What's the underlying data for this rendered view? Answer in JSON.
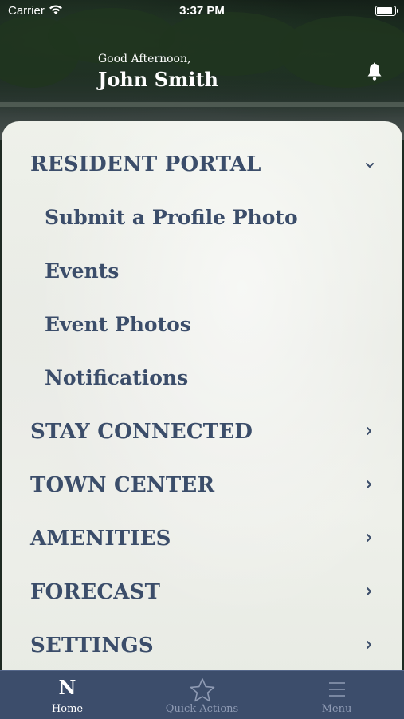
{
  "status_bar": {
    "carrier": "Carrier",
    "time": "3:37 PM",
    "battery_level": 0.95
  },
  "header": {
    "greeting": "Good Afternoon,",
    "user_name": "John Smith",
    "notification_icon": "bell-icon"
  },
  "menu": {
    "resident_portal": {
      "label": "RESIDENT PORTAL",
      "expanded": true,
      "items": [
        {
          "label": "Submit a Profile Photo"
        },
        {
          "label": "Events"
        },
        {
          "label": "Event Photos"
        },
        {
          "label": "Notifications"
        }
      ]
    },
    "sections": [
      {
        "label": "STAY CONNECTED"
      },
      {
        "label": "TOWN CENTER"
      },
      {
        "label": "AMENITIES"
      },
      {
        "label": "FORECAST"
      },
      {
        "label": "SETTINGS"
      }
    ]
  },
  "tab_bar": {
    "tabs": [
      {
        "label": "Home",
        "icon": "N",
        "active": true
      },
      {
        "label": "Quick Actions",
        "icon": "star-icon",
        "active": false
      },
      {
        "label": "Menu",
        "icon": "menu-icon",
        "active": false
      }
    ]
  },
  "colors": {
    "navy": "#3b4d6a",
    "tab_bar": "#3c4d6b",
    "panel": "#eceee8"
  }
}
